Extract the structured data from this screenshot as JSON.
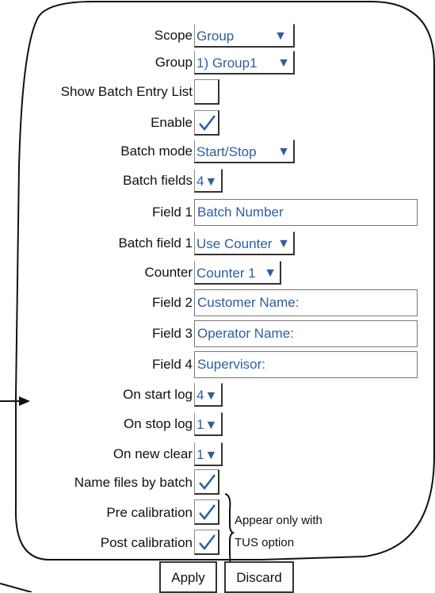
{
  "form": {
    "scope": {
      "label": "Scope",
      "value": "Group"
    },
    "group": {
      "label": "Group",
      "value": "1) Group1"
    },
    "show_batch_entry_list": {
      "label": "Show Batch Entry List",
      "checked": false
    },
    "enable": {
      "label": "Enable",
      "checked": true
    },
    "batch_mode": {
      "label": "Batch mode",
      "value": "Start/Stop"
    },
    "batch_fields": {
      "label": "Batch fields",
      "value": "4"
    },
    "field1": {
      "label": "Field 1",
      "value": "Batch Number"
    },
    "batch_field1": {
      "label": "Batch field 1",
      "value": "Use Counter"
    },
    "counter": {
      "label": "Counter",
      "value": "Counter 1"
    },
    "field2": {
      "label": "Field 2",
      "value": "Customer Name:"
    },
    "field3": {
      "label": "Field 3",
      "value": "Operator Name:"
    },
    "field4": {
      "label": "Field 4",
      "value": "Supervisor:"
    },
    "on_start_log": {
      "label": "On start log",
      "value": "4"
    },
    "on_stop_log": {
      "label": "On stop log",
      "value": "1"
    },
    "on_new_clear": {
      "label": "On new clear",
      "value": "1"
    },
    "name_files_by_batch": {
      "label": "Name files by batch",
      "checked": true
    },
    "pre_calibration": {
      "label": "Pre calibration",
      "checked": true
    },
    "post_calibration": {
      "label": "Post calibration",
      "checked": true
    }
  },
  "annotation": {
    "line1": "Appear only with",
    "line2": "TUS option"
  },
  "buttons": {
    "apply": "Apply",
    "discard": "Discard"
  },
  "colors": {
    "value_text": "#2e5ea0",
    "panel": "#ffffff",
    "outline": "#111111"
  }
}
